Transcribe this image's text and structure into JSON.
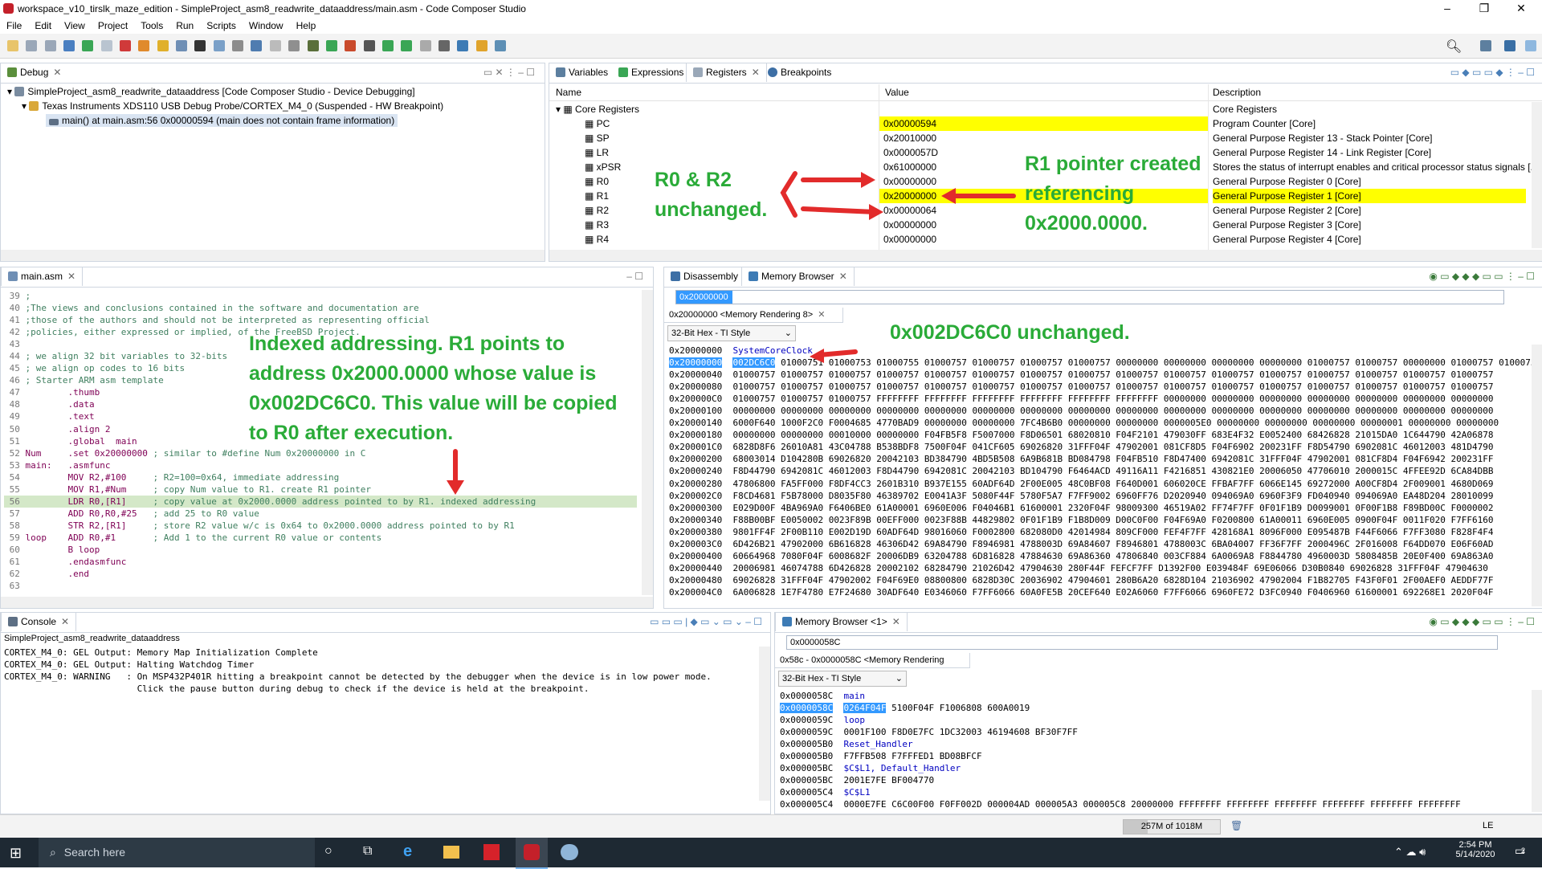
{
  "window": {
    "title": "workspace_v10_tirslk_maze_edition - SimpleProject_asm8_readwrite_dataaddress/main.asm - Code Composer Studio"
  },
  "menu": [
    "File",
    "Edit",
    "View",
    "Project",
    "Tools",
    "Run",
    "Scripts",
    "Window",
    "Help"
  ],
  "debug": {
    "tab": "Debug",
    "tree": [
      "SimpleProject_asm8_readwrite_dataaddress [Code Composer Studio - Device Debugging]",
      "Texas Instruments XDS110 USB Debug Probe/CORTEX_M4_0 (Suspended - HW Breakpoint)",
      "main() at main.asm:56 0x00000594  (main does not contain frame information)"
    ]
  },
  "registers": {
    "tabs": [
      "Variables",
      "Expressions",
      "Registers",
      "Breakpoints"
    ],
    "headers": {
      "name": "Name",
      "value": "Value",
      "desc": "Description"
    },
    "group": {
      "name": "Core Registers",
      "desc": "Core Registers"
    },
    "rows": [
      {
        "name": "PC",
        "value": "0x00000594",
        "desc": "Program Counter [Core]"
      },
      {
        "name": "SP",
        "value": "0x20010000",
        "desc": "General Purpose Register 13 - Stack Pointer [Core]"
      },
      {
        "name": "LR",
        "value": "0x0000057D",
        "desc": "General Purpose Register 14 - Link Register [Core]"
      },
      {
        "name": "xPSR",
        "value": "0x61000000",
        "desc": "Stores the status of interrupt enables and critical processor status signals [..."
      },
      {
        "name": "R0",
        "value": "0x00000000",
        "desc": "General Purpose Register 0 [Core]"
      },
      {
        "name": "R1",
        "value": "0x20000000",
        "desc": "General Purpose Register 1 [Core]"
      },
      {
        "name": "R2",
        "value": "0x00000064",
        "desc": "General Purpose Register 2 [Core]"
      },
      {
        "name": "R3",
        "value": "0x00000000",
        "desc": "General Purpose Register 3 [Core]"
      },
      {
        "name": "R4",
        "value": "0x00000000",
        "desc": "General Purpose Register 4 [Core]"
      }
    ]
  },
  "annotations": {
    "r0r2_line1": "R0 & R2",
    "r0r2_line2": "unchanged.",
    "r1_line1": "R1 pointer created",
    "r1_line2": "referencing",
    "r1_line3": "0x2000.0000.",
    "mem_unchanged": "0x002DC6C0 unchanged.",
    "indexed_1": "Indexed addressing. R1 points to",
    "indexed_2": "address 0x2000.0000 whose value is",
    "indexed_3": "0x002DC6C0. This value will be copied",
    "indexed_4": "to R0 after execution."
  },
  "editor": {
    "tab": "main.asm",
    "lines": [
      {
        "n": "39",
        "t": ";"
      },
      {
        "n": "40",
        "t": ";The views and conclusions contained in the software and documentation are"
      },
      {
        "n": "41",
        "t": ";those of the authors and should not be interpreted as representing official"
      },
      {
        "n": "42",
        "t": ";policies, either expressed or implied, of the FreeBSD Project."
      },
      {
        "n": "43",
        "t": ""
      },
      {
        "n": "44",
        "t": "; we align 32 bit variables to 32-bits"
      },
      {
        "n": "45",
        "t": "; we align op codes to 16 bits"
      },
      {
        "n": "46",
        "t": "; Starter ARM asm template"
      },
      {
        "n": "47",
        "t": "        .thumb"
      },
      {
        "n": "48",
        "t": "        .data"
      },
      {
        "n": "49",
        "t": "        .text"
      },
      {
        "n": "50",
        "t": "        .align 2"
      },
      {
        "n": "51",
        "t": "        .global  main"
      },
      {
        "n": "52",
        "t": "Num     .set 0x20000000 ; similar to #define Num 0x20000000 in C"
      },
      {
        "n": "53",
        "t": "main:   .asmfunc"
      },
      {
        "n": "54",
        "t": "        MOV R2,#100     ; R2=100=0x64, immediate addressing"
      },
      {
        "n": "55",
        "t": "        MOV R1,#Num     ; copy Num value to R1. create R1 pointer"
      },
      {
        "n": "56",
        "t": "        LDR R0,[R1]     ; copy value at 0x2000.0000 address pointed to by R1. indexed addressing"
      },
      {
        "n": "57",
        "t": "        ADD R0,R0,#25   ; add 25 to R0 value"
      },
      {
        "n": "58",
        "t": "        STR R2,[R1]     ; store R2 value w/c is 0x64 to 0x2000.0000 address pointed to by R1"
      },
      {
        "n": "59",
        "t": "loop    ADD R0,#1       ; Add 1 to the current R0 value or contents"
      },
      {
        "n": "60",
        "t": "        B loop"
      },
      {
        "n": "61",
        "t": "        .endasmfunc"
      },
      {
        "n": "62",
        "t": "        .end"
      },
      {
        "n": "63",
        "t": ""
      }
    ]
  },
  "memory1": {
    "tabs": [
      "Disassembly",
      "Memory Browser"
    ],
    "address_input": "0x20000000",
    "rendering_tab": "0x20000000 <Memory Rendering 8>",
    "format": "32-Bit Hex - TI Style",
    "symbol": "SystemCoreClock",
    "lines": [
      {
        "a": "0x20000000",
        "v": "002DC6C0 01000751 01000753 01000755 01000757 01000757 01000757 01000757 00000000 00000000 00000000 00000000 01000757 01000757 00000000 01000757 01000757"
      },
      {
        "a": "0x20000040",
        "v": "01000757 01000757 01000757 01000757 01000757 01000757 01000757 01000757 01000757 01000757 01000757 01000757 01000757 01000757 01000757 01000757"
      },
      {
        "a": "0x20000080",
        "v": "01000757 01000757 01000757 01000757 01000757 01000757 01000757 01000757 01000757 01000757 01000757 01000757 01000757 01000757 01000757 01000757"
      },
      {
        "a": "0x200000C0",
        "v": "01000757 01000757 01000757 FFFFFFFF FFFFFFFF FFFFFFFF FFFFFFFF FFFFFFFF FFFFFFFF 00000000 00000000 00000000 00000000 00000000 00000000 00000000"
      },
      {
        "a": "0x20000100",
        "v": "00000000 00000000 00000000 00000000 00000000 00000000 00000000 00000000 00000000 00000000 00000000 00000000 00000000 00000000 00000000 00000000"
      },
      {
        "a": "0x20000140",
        "v": "6000F640 1000F2C0 F0004685 4770BAD9 00000000 00000000 7FC4B6B0 00000000 00000000 0000005E0 00000000 00000000 00000000 00000001 00000000 00000000"
      },
      {
        "a": "0x20000180",
        "v": "00000000 00000000 00010000 00000000 F04FB5F8 F5007000 F8D06501 68020810 F04F2101 479030FF 683E4F32 E0052400 68426828 21015DA0 1C644790 42A06878"
      },
      {
        "a": "0x200001C0",
        "v": "6828D8F6 26010A81 43C04788 B538BDF8 7500F04F 041CF605 69026820 31FFF04F 47902001 081CF8D5 F04F6902 200231FF F8D54790 6902081C 46012003 481D4790"
      },
      {
        "a": "0x20000200",
        "v": "68003014 D104280B 69026820 20042103 BD384790 4BD5B508 6A9B681B BD084798 F04FB510 F8D47400 6942081C 31FFF04F 47902001 081CF8D4 F04F6942 200231FF"
      },
      {
        "a": "0x20000240",
        "v": "F8D44790 6942081C 46012003 F8D44790 6942081C 20042103 BD104790 F6464ACD 49116A11 F4216851 430821E0 20006050 47706010 2000015C 4FFEE92D 6CA84DBB"
      },
      {
        "a": "0x20000280",
        "v": "47806800 FA5FF000 F8DF4CC3 2601B310 B937E155 60ADF64D 2F00E005 48C0BF08 F640D001 606020CE FFBAF7FF 6066E145 69272000 A00CF8D4 2F009001 4680D069"
      },
      {
        "a": "0x200002C0",
        "v": "F8CD4681 F5B78000 D8035F80 46389702 E0041A3F 5080F44F 5780F5A7 F7FF9002 6960FF76 D2020940 094069A0 6960F3F9 FD040940 094069A0 EA48D204 28010099"
      },
      {
        "a": "0x20000300",
        "v": "E029D00F 4BA969A0 F6406BE0 61A00001 6960E006 F04046B1 61600001 2320F04F 98009300 46519A02 FF74F7FF 0F01F1B9 D0099001 0F00F1B8 F89BD00C F0000002"
      },
      {
        "a": "0x20000340",
        "v": "F88B00BF E0050002 0023F89B 00EFF000 0023F88B 44829802 0F01F1B9 F1B8D009 D00C0F00 F04F69A0 F0200800 61A00011 6960E005 0900F04F 0011F020 F7FF6160"
      },
      {
        "a": "0x20000380",
        "v": "9801FF4F 2F00B110 E002D19D 60ADF64D 98016060 F0002800 682080D0 42014984 809CF000 FEF4F7FF 428168A1 8096F000 E095487B F44F6066 F7FF3080 F828F4F4"
      },
      {
        "a": "0x200003C0",
        "v": "6D426B21 47902000 6B616828 46306D42 69A84790 F8946981 4788003D 69A84607 F8946801 4788003C 6BA04007 FF36F7FF 2000496C 2F016008 F64DD070 E06F60AD"
      },
      {
        "a": "0x20000400",
        "v": "60664968 7080F04F 6008682F 20006DB9 63204788 6D816828 47884630 69A86360 47806840 003CF884 6A0069A8 F8844780 4960003D 5808485B 20E0F400 69A863A0"
      },
      {
        "a": "0x20000440",
        "v": "20006981 46074788 6D426828 20002102 68284790 21026D42 47904630 280F44F FEFCF7FF D1392F00 E039484F 69E06066 D30B0840 69026828 31FFF04F 47904630"
      },
      {
        "a": "0x20000480",
        "v": "69026828 31FFF04F 47902002 F04F69E0 08800800 6828D30C 20036902 47904601 280B6A20 6828D104 21036902 47902004 F1B82705 F43F0F01 2F00AEF0 AEDDF77F"
      },
      {
        "a": "0x200004C0",
        "v": "6A006828 1E7F4780 E7F24680 30ADF640 E0346060 F7FF6066 60A0FE5B 20CEF640 E02A6060 F7FF6066 6960FE72 D3FC0940 F0406960 61600001 692268E1 2020F04F"
      }
    ]
  },
  "console": {
    "tab": "Console",
    "project": "SimpleProject_asm8_readwrite_dataaddress",
    "lines": [
      "CORTEX_M4_0: GEL Output: Memory Map Initialization Complete",
      "CORTEX_M4_0: GEL Output: Halting Watchdog Timer",
      "CORTEX_M4_0: WARNING   : On MSP432P401R hitting a breakpoint cannot be detected by the debugger when the device is in low power mode.",
      "                         Click the pause button during debug to check if the device is held at the breakpoint."
    ]
  },
  "memory2": {
    "tab": "Memory Browser <1>",
    "address_input": "0x0000058C",
    "rendering_tab": "0x58c - 0x0000058C <Memory Rendering 7>",
    "format": "32-Bit Hex - TI Style",
    "lines": [
      {
        "a": "0x0000058C",
        "v": "main",
        "sym": true
      },
      {
        "a": "0x0000058C",
        "v": "0264F04F 5100F04F F1006808 600A0019",
        "sel": true
      },
      {
        "a": "0x0000059C",
        "v": "loop",
        "sym": true
      },
      {
        "a": "0x0000059C",
        "v": "0001F100 F8D0E7FC 1DC32003 46194608 BF30F7FF"
      },
      {
        "a": "0x000005B0",
        "v": "Reset_Handler",
        "sym": true
      },
      {
        "a": "0x000005B0",
        "v": "F7FFB508 F7FFFED1 BD08BFCF"
      },
      {
        "a": "0x000005BC",
        "v": "$C$L1, Default_Handler",
        "sym": true
      },
      {
        "a": "0x000005BC",
        "v": "2001E7FE BF004770"
      },
      {
        "a": "0x000005C4",
        "v": "$C$L1",
        "sym": true
      },
      {
        "a": "0x000005C4",
        "v": "0000E7FE C6C00F00 F0FF002D 000004AD 000005A3 000005C8 20000000 FFFFFFFF FFFFFFFF FFFFFFFF FFFFFFFF FFFFFFFF FFFFFFFF"
      }
    ]
  },
  "status": {
    "heap": "257M of 1018M",
    "le": "LE"
  },
  "taskbar": {
    "search": "Search here",
    "time": "2:54 PM",
    "date": "5/14/2020",
    "notif": "2"
  }
}
